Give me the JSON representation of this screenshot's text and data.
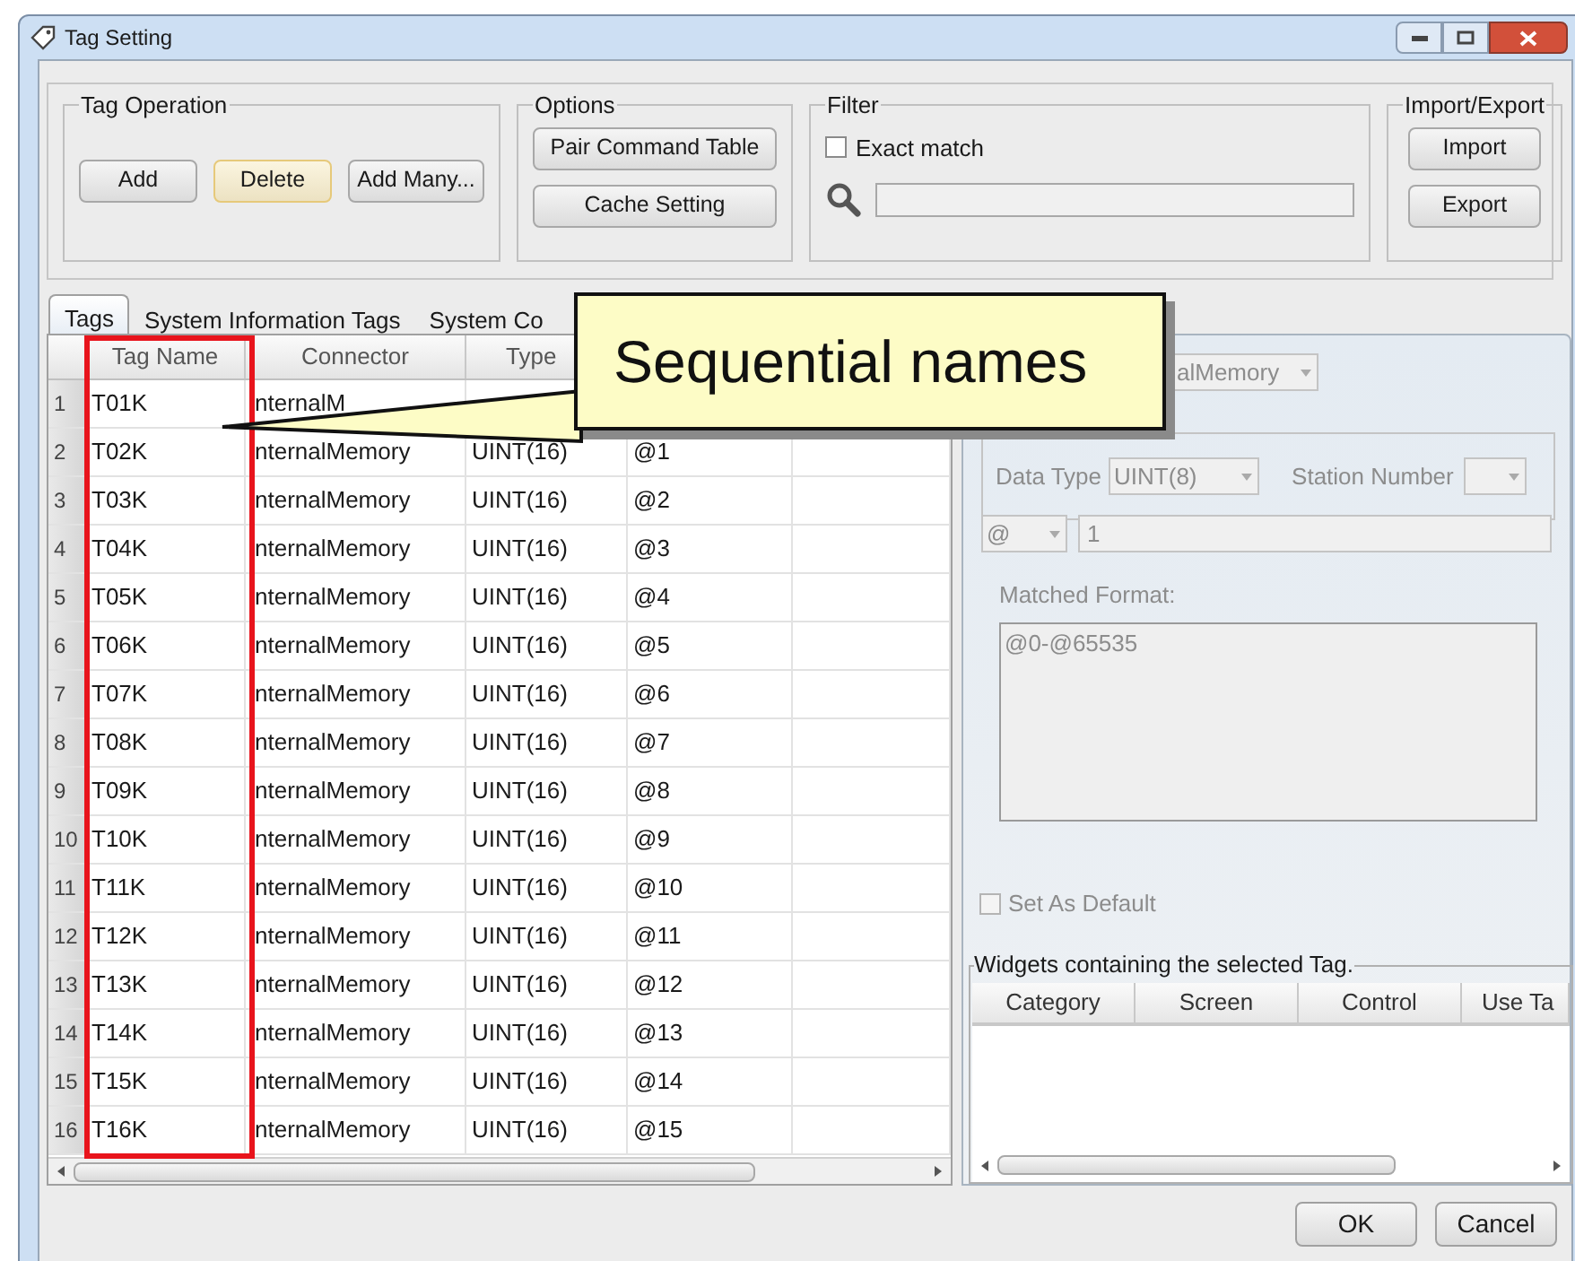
{
  "window": {
    "title": "Tag Setting"
  },
  "groups": [
    {
      "kind": "buttons",
      "title": "Tag Operation",
      "buttons": [
        {
          "label": "Add",
          "focused": false
        },
        {
          "label": "Delete",
          "focused": true
        },
        {
          "label": "Add Many...",
          "focused": false
        }
      ]
    },
    {
      "kind": "stack",
      "title": "Options",
      "buttons": [
        {
          "label": "Pair Command Table",
          "focused": false
        },
        {
          "label": "Cache Setting",
          "focused": false
        }
      ]
    },
    {
      "kind": "filter",
      "title": "Filter",
      "exact_match": {
        "label": "Exact match",
        "checked": false
      }
    },
    {
      "kind": "stack",
      "title": "Import/Export",
      "buttons": [
        {
          "label": "Import",
          "focused": false
        },
        {
          "label": "Export",
          "focused": false
        }
      ]
    }
  ],
  "tabs": [
    {
      "label": "Tags",
      "selected": true
    },
    {
      "label": "System Information Tags",
      "selected": false
    },
    {
      "label": "System Co",
      "selected": false
    }
  ],
  "table": {
    "columns": [
      "Tag Name",
      "Connector",
      "Type"
    ],
    "rows": [
      {
        "number": "1",
        "cells": [
          "T01K",
          "nternalM"
        ]
      },
      {
        "number": "2",
        "cells": [
          "T02K",
          "nternalMemory",
          "UINT(16)",
          "@1"
        ]
      },
      {
        "number": "3",
        "cells": [
          "T03K",
          "nternalMemory",
          "UINT(16)",
          "@2"
        ]
      },
      {
        "number": "4",
        "cells": [
          "T04K",
          "nternalMemory",
          "UINT(16)",
          "@3"
        ]
      },
      {
        "number": "5",
        "cells": [
          "T05K",
          "nternalMemory",
          "UINT(16)",
          "@4"
        ]
      },
      {
        "number": "6",
        "cells": [
          "T06K",
          "nternalMemory",
          "UINT(16)",
          "@5"
        ]
      },
      {
        "number": "7",
        "cells": [
          "T07K",
          "nternalMemory",
          "UINT(16)",
          "@6"
        ]
      },
      {
        "number": "8",
        "cells": [
          "T08K",
          "nternalMemory",
          "UINT(16)",
          "@7"
        ]
      },
      {
        "number": "9",
        "cells": [
          "T09K",
          "nternalMemory",
          "UINT(16)",
          "@8"
        ]
      },
      {
        "number": "10",
        "cells": [
          "T10K",
          "nternalMemory",
          "UINT(16)",
          "@9"
        ]
      },
      {
        "number": "11",
        "cells": [
          "T11K",
          "nternalMemory",
          "UINT(16)",
          "@10"
        ]
      },
      {
        "number": "12",
        "cells": [
          "T12K",
          "nternalMemory",
          "UINT(16)",
          "@11"
        ]
      },
      {
        "number": "13",
        "cells": [
          "T13K",
          "nternalMemory",
          "UINT(16)",
          "@12"
        ]
      },
      {
        "number": "14",
        "cells": [
          "T14K",
          "nternalMemory",
          "UINT(16)",
          "@13"
        ]
      },
      {
        "number": "15",
        "cells": [
          "T15K",
          "nternalMemory",
          "UINT(16)",
          "@14"
        ]
      },
      {
        "number": "16",
        "cells": [
          "T16K",
          "nternalMemory",
          "UINT(16)",
          "@15"
        ]
      }
    ]
  },
  "details": {
    "disabled": true,
    "connector": "alMemory",
    "data_type": {
      "label": "Data Type",
      "value": "UINT(8)"
    },
    "station_number": {
      "label": "Station Number"
    },
    "address_prefix": "@",
    "address": "1",
    "matched_format": {
      "label": "Matched Format:",
      "text": "@0-@65535"
    },
    "set_as_default": {
      "label": "Set As Default",
      "checked": false
    }
  },
  "widgets": {
    "title": "Widgets containing the selected Tag.",
    "columns": [
      "Category",
      "Screen",
      "Control",
      "Use Ta"
    ]
  },
  "buttons": [
    "OK",
    "Cancel"
  ],
  "callout": {
    "text": "Sequential names"
  }
}
